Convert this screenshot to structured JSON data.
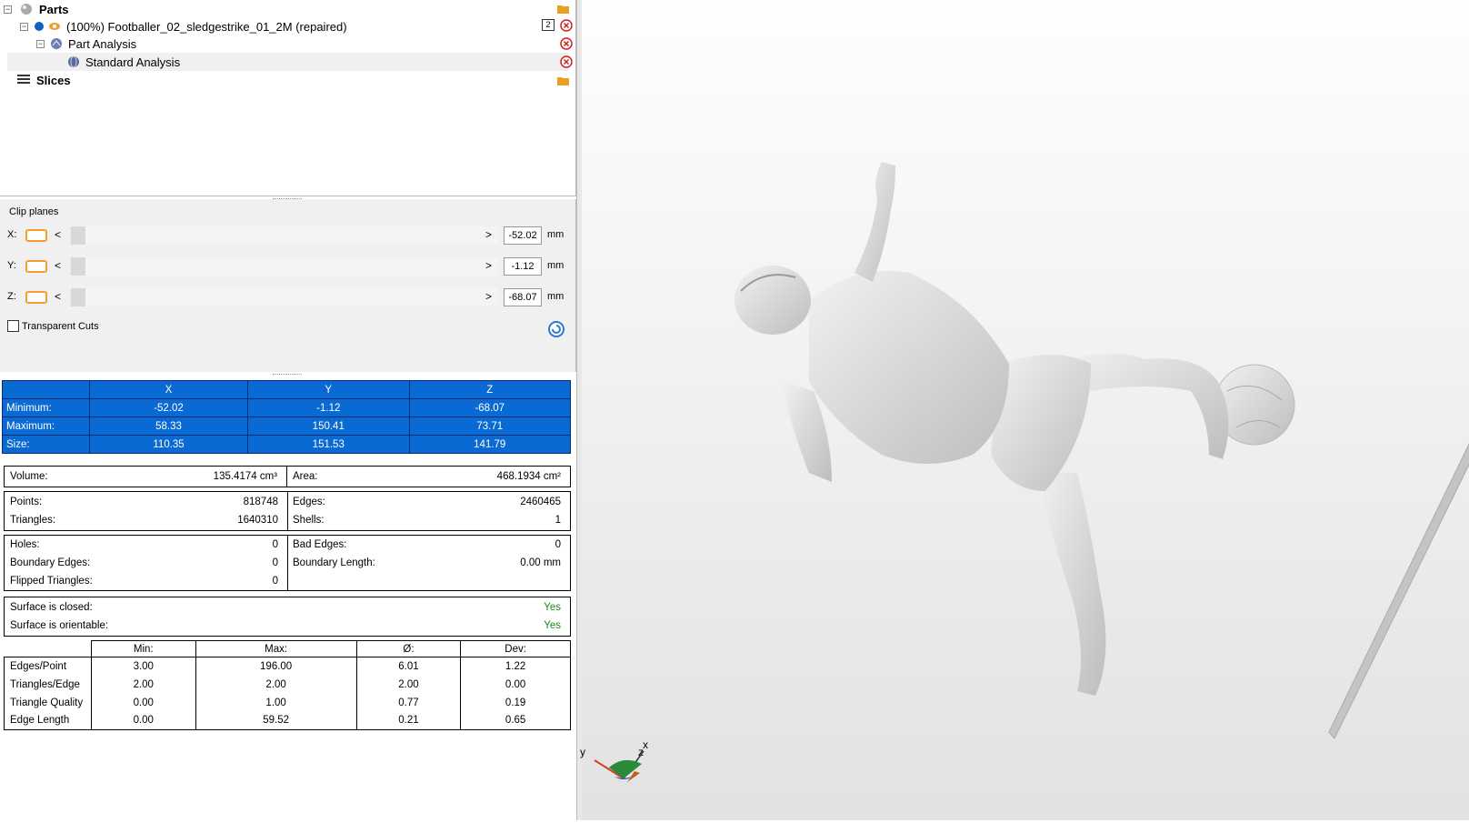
{
  "tree": {
    "parts_label": "Parts",
    "part_name": "(100%) Footballer_02_sledgestrike_01_2M (repaired)",
    "part_badge": "2",
    "analysis_label": "Part Analysis",
    "standard_label": "Standard Analysis",
    "slices_label": "Slices"
  },
  "clip": {
    "title": "Clip planes",
    "x_label": "X:",
    "y_label": "Y:",
    "z_label": "Z:",
    "x_value": "-52.02",
    "y_value": "-1.12",
    "z_value": "-68.07",
    "unit": "mm",
    "transparent_label": "Transparent Cuts",
    "lt": "<",
    "gt": ">"
  },
  "bbox": {
    "headers": [
      "X",
      "Y",
      "Z"
    ],
    "rows": [
      {
        "label": "Minimum:",
        "v": [
          "-52.02",
          "-1.12",
          "-68.07"
        ]
      },
      {
        "label": "Maximum:",
        "v": [
          "58.33",
          "150.41",
          "73.71"
        ]
      },
      {
        "label": "Size:",
        "v": [
          "110.35",
          "151.53",
          "141.79"
        ]
      }
    ]
  },
  "volume": {
    "label": "Volume:",
    "value": "135.4174 cm³",
    "area_label": "Area:",
    "area_value": "468.1934 cm²"
  },
  "mesh": {
    "points_label": "Points:",
    "points": "818748",
    "triangles_label": "Triangles:",
    "triangles": "1640310",
    "edges_label": "Edges:",
    "edges": "2460465",
    "shells_label": "Shells:",
    "shells": "1"
  },
  "errors": {
    "holes_label": "Holes:",
    "holes": "0",
    "boundary_edges_label": "Boundary Edges:",
    "boundary_edges": "0",
    "flipped_label": "Flipped Triangles:",
    "flipped": "0",
    "bad_edges_label": "Bad Edges:",
    "bad_edges": "0",
    "boundary_length_label": "Boundary Length:",
    "boundary_length": "0.00 mm"
  },
  "surface": {
    "closed_label": "Surface is closed:",
    "closed": "Yes",
    "orientable_label": "Surface is orientable:",
    "orientable": "Yes",
    "ok_color": "#1a8a1a"
  },
  "stats": {
    "headers": [
      "Min:",
      "Max:",
      "Ø:",
      "Dev:"
    ],
    "rows": [
      {
        "label": "Edges/Point",
        "v": [
          "3.00",
          "196.00",
          "6.01",
          "1.22"
        ]
      },
      {
        "label": "Triangles/Edge",
        "v": [
          "2.00",
          "2.00",
          "2.00",
          "0.00"
        ]
      },
      {
        "label": "Triangle Quality",
        "v": [
          "0.00",
          "1.00",
          "0.77",
          "0.19"
        ]
      },
      {
        "label": "Edge Length",
        "v": [
          "0.00",
          "59.52",
          "0.21",
          "0.65"
        ]
      }
    ]
  },
  "axes": {
    "x": "x",
    "y": "y",
    "z": "z"
  }
}
